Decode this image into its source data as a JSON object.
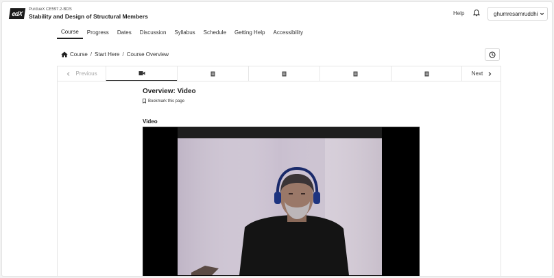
{
  "header": {
    "logo_text": "edX",
    "course_org": "PurdueX CE597.2-BDS",
    "course_title": "Stability and Design of Structural Members",
    "help_label": "Help",
    "username": "ghumresamruddhi"
  },
  "tabs": [
    {
      "label": "Course",
      "active": true
    },
    {
      "label": "Progress"
    },
    {
      "label": "Dates"
    },
    {
      "label": "Discussion"
    },
    {
      "label": "Syllabus"
    },
    {
      "label": "Schedule"
    },
    {
      "label": "Getting Help"
    },
    {
      "label": "Accessibility"
    }
  ],
  "breadcrumb": [
    "Course",
    "Start Here",
    "Course Overview"
  ],
  "sequence": {
    "previous_label": "Previous",
    "next_label": "Next",
    "units": [
      {
        "icon": "video-icon",
        "active": true
      },
      {
        "icon": "document-icon"
      },
      {
        "icon": "document-icon"
      },
      {
        "icon": "document-icon"
      },
      {
        "icon": "document-icon"
      }
    ]
  },
  "content": {
    "unit_title": "Overview: Video",
    "bookmark_label": "Bookmark this page",
    "video_label": "Video"
  },
  "colors": {
    "accent": "#1f1f1f",
    "border": "#e6e6e6",
    "muted": "#a8a8a8"
  }
}
